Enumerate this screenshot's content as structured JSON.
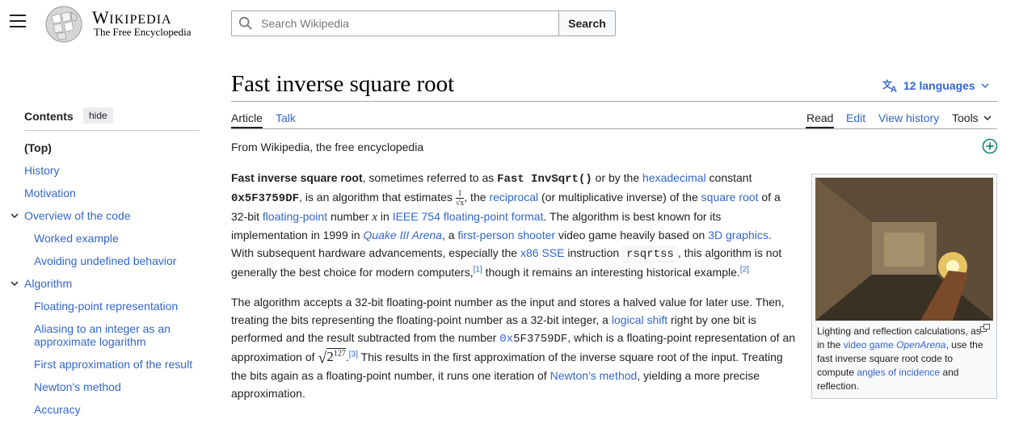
{
  "header": {
    "wordmark_big": "W",
    "wordmark_rest": "IKIPEDIA",
    "tagline": "The Free Encyclopedia",
    "search_placeholder": "Search Wikipedia",
    "search_button": "Search"
  },
  "toc": {
    "heading": "Contents",
    "hide_label": "hide",
    "items": [
      {
        "label": "(Top)"
      },
      {
        "label": "History"
      },
      {
        "label": "Motivation"
      },
      {
        "label": "Overview of the code"
      },
      {
        "label": "Worked example"
      },
      {
        "label": "Avoiding undefined behavior"
      },
      {
        "label": "Algorithm"
      },
      {
        "label": "Floating-point representation"
      },
      {
        "label": "Aliasing to an integer as an approximate logarithm"
      },
      {
        "label": "First approximation of the result"
      },
      {
        "label": "Newton's method"
      },
      {
        "label": "Accuracy"
      }
    ]
  },
  "article": {
    "title": "Fast inverse square root",
    "languages": "12 languages",
    "tabs": {
      "article": "Article",
      "talk": "Talk",
      "read": "Read",
      "edit": "Edit",
      "history": "View history",
      "tools": "Tools"
    },
    "from_wiki": "From Wikipedia, the free encyclopedia"
  },
  "p1": {
    "b1": "Fast inverse square root",
    "t1": ", sometimes referred to as ",
    "b2": "Fast InvSqrt()",
    "t2": " or by the ",
    "l1": "hexadecimal",
    "t3": " constant ",
    "b3": "0x5F3759DF",
    "t4": ", is an algorithm that estimates ",
    "frac_num": "1",
    "frac_den": "√x",
    "t5": ", the ",
    "l2": "reciprocal",
    "t6": " (or multiplicative inverse) of the ",
    "l3": "square root",
    "t7": " of a 32-bit ",
    "l4": "floating-point",
    "t8": " number ",
    "x": "x",
    "t9": " in ",
    "l5": "IEEE 754 floating-point format",
    "t10": ". The algorithm is best known for its implementation in 1999 in ",
    "l6": "Quake III Arena",
    "t11": ", a ",
    "l7": "first-person shooter",
    "t12": " video game heavily based on ",
    "l8": "3D graphics",
    "t13": ". With subsequent hardware advancements, especially the ",
    "l9": "x86 SSE",
    "t14": " instruction ",
    "code1": "rsqrtss",
    "t15": ", this algorithm is not generally the best choice for modern computers,",
    "ref1": "[1]",
    "t16": " though it remains an interesting historical example.",
    "ref2": "[2]"
  },
  "p2": {
    "t1": "The algorithm accepts a 32-bit floating-point number as the input and stores a halved value for later use. Then, treating the bits representing the floating-point number as a 32-bit integer, a ",
    "l1": "logical shift",
    "t2": " right by one bit is performed and the result subtracted from the number ",
    "hex_prefix": "0x",
    "hex_rest": "5F3759DF",
    "t3": ", which is a floating-point representation of an approximation of ",
    "sqrt_base": "2",
    "sqrt_exp": "127",
    "ref3": "[3]",
    "t4": " This results in the first approximation of the inverse square root of the input. Treating the bits again as a floating-point number, it runs one iteration of ",
    "l2": "Newton's method",
    "t5": ", yielding a more precise approximation."
  },
  "thumb": {
    "t1": "Lighting and reflection calculations, as in the ",
    "l1": "video game",
    "t2": " ",
    "l2": "OpenArena",
    "t3": ", use the fast inverse square root code to compute ",
    "l3": "angles of incidence",
    "t4": " and reflection."
  }
}
